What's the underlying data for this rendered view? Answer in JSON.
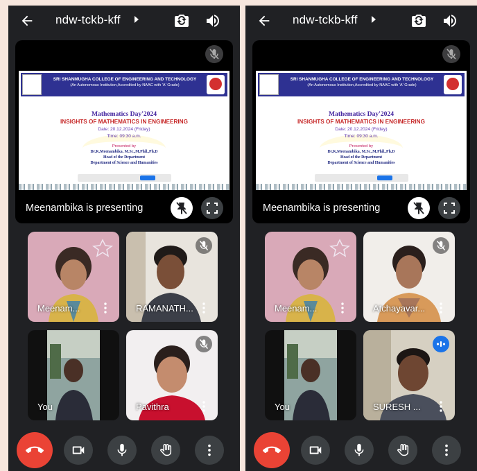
{
  "colors": {
    "background": "#f7e6dd",
    "app_bg": "#202124",
    "end_call": "#ea4335",
    "control_button": "#3c4043",
    "speaking_indicator": "#1a73e8",
    "slide_banner": "#2e3192"
  },
  "screens": [
    {
      "meeting_code": "ndw-tckb-kff",
      "presenter_status": "Meenambika is presenting",
      "slide": {
        "college": "SRI SHANMUGHA COLLEGE OF ENGINEERING AND TECHNOLOGY",
        "accreditation": "(An Autonomous Institution,Accredited by NAAC with 'A' Grade)",
        "event": "Mathematics Day'2024",
        "topic": "INSIGHTS OF MATHEMATICS IN ENGINEERING",
        "date": "Date: 20.12.2024 (Friday)",
        "time": "Time: 09:30 a.m.",
        "presented_by": "Presented by",
        "presenter": "Dr.K.Meenambika, M.Sc.,M.Phil.,Ph.D",
        "role": "Head of the Department",
        "department": "Department of Science and Humanities"
      },
      "participants": [
        {
          "name": "Meenam...",
          "mic": "on"
        },
        {
          "name": "RAMANATH...",
          "mic": "off"
        },
        {
          "name": "You",
          "mic": "on"
        },
        {
          "name": "Pavithra",
          "mic": "off"
        }
      ]
    },
    {
      "meeting_code": "ndw-tckb-kff",
      "presenter_status": "Meenambika is presenting",
      "slide": {
        "college": "SRI SHANMUGHA COLLEGE OF ENGINEERING AND TECHNOLOGY",
        "accreditation": "(An Autonomous Institution,Accredited by NAAC with 'A' Grade)",
        "event": "Mathematics Day'2024",
        "topic": "INSIGHTS OF MATHEMATICS IN ENGINEERING",
        "date": "Date: 20.12.2024 (Friday)",
        "time": "Time: 09:30 a.m.",
        "presented_by": "Presented by",
        "presenter": "Dr.K.Meenambika, M.Sc.,M.Phil.,Ph.D",
        "role": "Head of the Department",
        "department": "Department of Science and Humanities"
      },
      "participants": [
        {
          "name": "Meenam...",
          "mic": "on"
        },
        {
          "name": "Atchayavar...",
          "mic": "off"
        },
        {
          "name": "You",
          "mic": "on"
        },
        {
          "name": "SURESH ...",
          "mic": "speaking"
        }
      ]
    }
  ],
  "icons": {
    "top_bar": [
      "arrow-back-icon",
      "caret-right-icon",
      "camera-switch-icon",
      "volume-icon"
    ],
    "controls": [
      "call-end-icon",
      "video-camera-icon",
      "microphone-icon",
      "raise-hand-icon",
      "more-vert-icon"
    ]
  }
}
